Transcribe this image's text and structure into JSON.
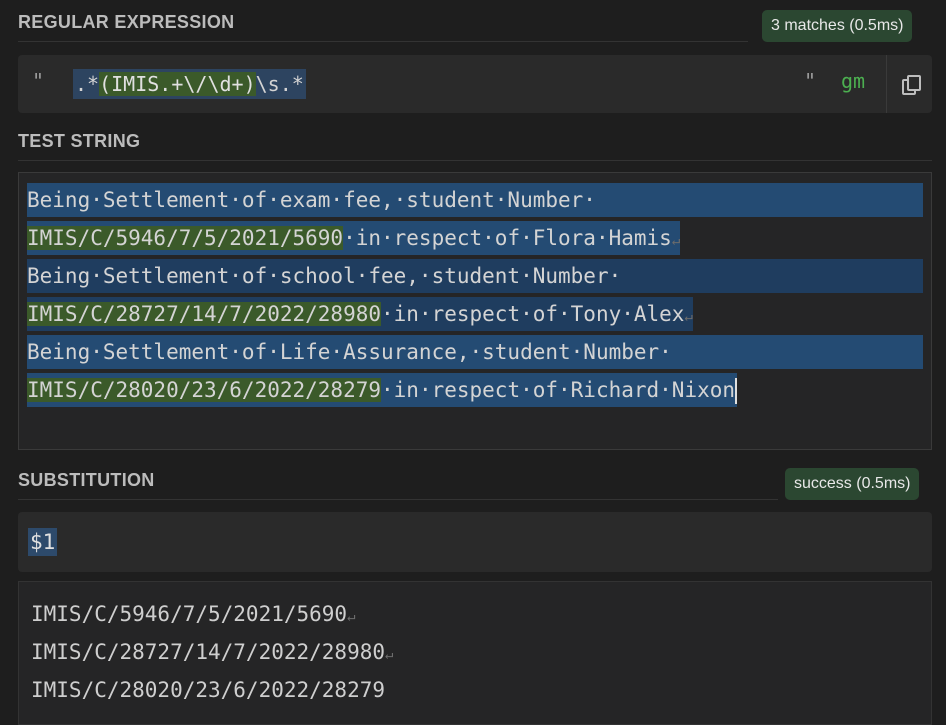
{
  "regex_section": {
    "title": "REGULAR EXPRESSION",
    "match_badge": "3 matches (0.5ms)",
    "open_delim": "\"",
    "close_delim": "\"",
    "pattern_prefix": ".*",
    "pattern_group": "(IMIS.+\\/\\d+)",
    "pattern_suffix": "\\s.*",
    "flags": "gm",
    "copy_icon": "copy-icon"
  },
  "test_section": {
    "title": "TEST STRING",
    "lines": [
      {
        "pre": "Being·Settlement·of·exam·fee,·student·Number·",
        "group": "",
        "post": "",
        "eol": ""
      },
      {
        "pre": "",
        "group": "IMIS/C/5946/7/5/2021/5690",
        "post": "·in·respect·of·Flora·Hamis",
        "eol": "↵"
      },
      {
        "pre": "Being·Settlement·of·school·fee,·student·Number·",
        "group": "",
        "post": "",
        "eol": ""
      },
      {
        "pre": "",
        "group": "IMIS/C/28727/14/7/2022/28980",
        "post": "·in·respect·of·Tony·Alex",
        "eol": "↵"
      },
      {
        "pre": "Being·Settlement·of·Life·Assurance,·student·Number·",
        "group": "",
        "post": "",
        "eol": ""
      },
      {
        "pre": "",
        "group": "IMIS/C/28020/23/6/2022/28279",
        "post": "·in·respect·of·Richard·Nixon",
        "eol": ""
      }
    ]
  },
  "substitution_section": {
    "title": "SUBSTITUTION",
    "status_badge": "success (0.5ms)",
    "value": "$1",
    "results": [
      {
        "text": "IMIS/C/5946/7/5/2021/5690",
        "eol": "↵"
      },
      {
        "text": "IMIS/C/28727/14/7/2022/28980",
        "eol": "↵"
      },
      {
        "text": "IMIS/C/28020/23/6/2022/28279",
        "eol": ""
      }
    ]
  },
  "colors": {
    "match_highlight": "#244b73",
    "group_highlight": "#3b5a2a",
    "flags": "#4caf50",
    "badge_bg": "#2b4731"
  }
}
